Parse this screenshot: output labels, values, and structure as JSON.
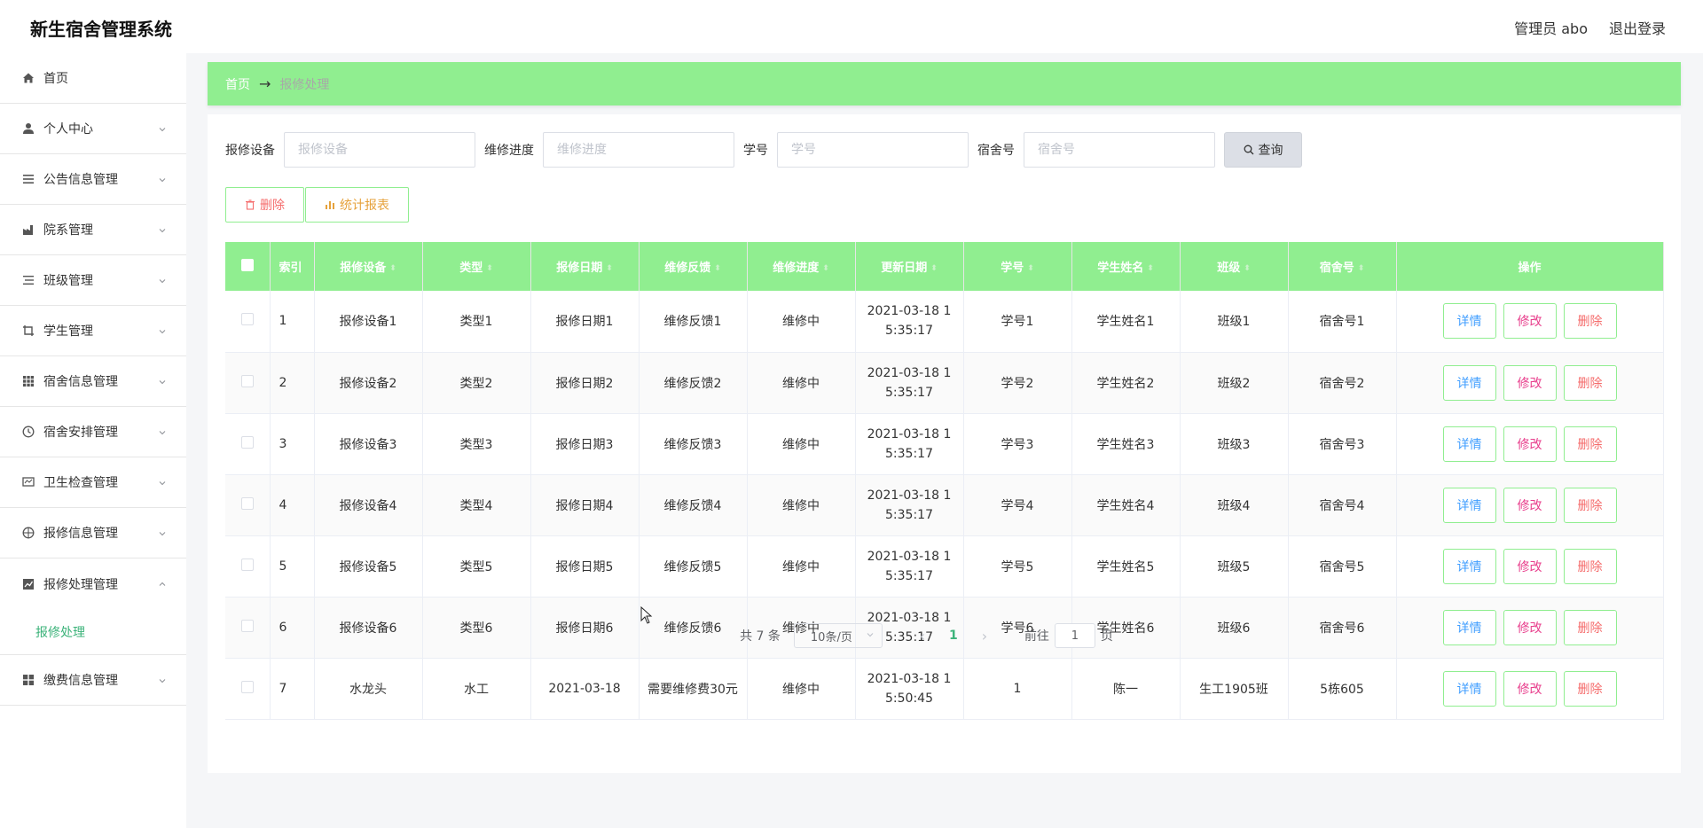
{
  "app": {
    "title": "新生宿舍管理系统",
    "user_label": "管理员 abo",
    "logout": "退出登录"
  },
  "sidebar": {
    "items": [
      {
        "label": "首页",
        "icon": "home-icon",
        "expandable": false
      },
      {
        "label": "个人中心",
        "icon": "user-icon",
        "expandable": true
      },
      {
        "label": "公告信息管理",
        "icon": "menu-icon",
        "expandable": true
      },
      {
        "label": "院系管理",
        "icon": "factory-icon",
        "expandable": true
      },
      {
        "label": "班级管理",
        "icon": "list-icon",
        "expandable": true
      },
      {
        "label": "学生管理",
        "icon": "crop-icon",
        "expandable": true
      },
      {
        "label": "宿舍信息管理",
        "icon": "grid-icon",
        "expandable": true
      },
      {
        "label": "宿舍安排管理",
        "icon": "clock-icon",
        "expandable": true
      },
      {
        "label": "卫生检查管理",
        "icon": "monitor-icon",
        "expandable": true
      },
      {
        "label": "报修信息管理",
        "icon": "target-icon",
        "expandable": true
      },
      {
        "label": "报修处理管理",
        "icon": "chart-icon",
        "expandable": true,
        "open": true
      },
      {
        "label": "缴费信息管理",
        "icon": "apps-icon",
        "expandable": true
      }
    ],
    "submenu": {
      "label": "报修处理"
    }
  },
  "breadcrumb": {
    "home": "首页",
    "current": "报修处理"
  },
  "search": {
    "fields": [
      {
        "label": "报修设备",
        "placeholder": "报修设备"
      },
      {
        "label": "维修进度",
        "placeholder": "维修进度"
      },
      {
        "label": "学号",
        "placeholder": "学号"
      },
      {
        "label": "宿舍号",
        "placeholder": "宿舍号"
      }
    ],
    "query_label": "查询"
  },
  "actions": {
    "delete_label": "删除",
    "report_label": "统计报表"
  },
  "table": {
    "columns": [
      "索引",
      "报修设备",
      "类型",
      "报修日期",
      "维修反馈",
      "维修进度",
      "更新日期",
      "学号",
      "学生姓名",
      "班级",
      "宿舍号",
      "操作"
    ],
    "rows": [
      [
        "1",
        "报修设备1",
        "类型1",
        "报修日期1",
        "维修反馈1",
        "维修中",
        "2021-03-18 1",
        "5:35:17",
        "学号1",
        "学生姓名1",
        "班级1",
        "宿舍号1"
      ],
      [
        "2",
        "报修设备2",
        "类型2",
        "报修日期2",
        "维修反馈2",
        "维修中",
        "2021-03-18 1",
        "5:35:17",
        "学号2",
        "学生姓名2",
        "班级2",
        "宿舍号2"
      ],
      [
        "3",
        "报修设备3",
        "类型3",
        "报修日期3",
        "维修反馈3",
        "维修中",
        "2021-03-18 1",
        "5:35:17",
        "学号3",
        "学生姓名3",
        "班级3",
        "宿舍号3"
      ],
      [
        "4",
        "报修设备4",
        "类型4",
        "报修日期4",
        "维修反馈4",
        "维修中",
        "2021-03-18 1",
        "5:35:17",
        "学号4",
        "学生姓名4",
        "班级4",
        "宿舍号4"
      ],
      [
        "5",
        "报修设备5",
        "类型5",
        "报修日期5",
        "维修反馈5",
        "维修中",
        "2021-03-18 1",
        "5:35:17",
        "学号5",
        "学生姓名5",
        "班级5",
        "宿舍号5"
      ],
      [
        "6",
        "报修设备6",
        "类型6",
        "报修日期6",
        "维修反馈6",
        "维修中",
        "2021-03-18 1",
        "5:35:17",
        "学号6",
        "学生姓名6",
        "班级6",
        "宿舍号6"
      ],
      [
        "7",
        "水龙头",
        "水工",
        "2021-03-18",
        "需要维修费30元",
        "维修中",
        "2021-03-18 1",
        "5:50:45",
        "1",
        "陈一",
        "生工1905班",
        "5栋605"
      ]
    ],
    "row_actions": {
      "detail": "详情",
      "edit": "修改",
      "delete": "删除"
    }
  },
  "pagination": {
    "total": "共 7 条",
    "page_size": "10条/页",
    "current_page": "1",
    "goto_prefix": "前往",
    "goto_value": "1",
    "goto_suffix": "页"
  },
  "colors": {
    "accent": "#90ee90",
    "active_text": "#3cb37a",
    "danger": "#f56c6c",
    "warning": "#e6a23c",
    "info": "#409eff"
  }
}
